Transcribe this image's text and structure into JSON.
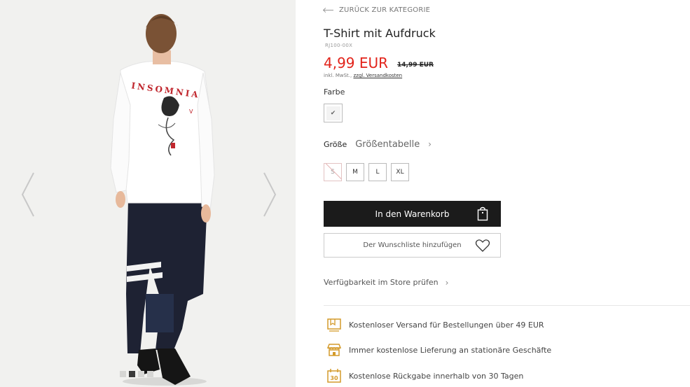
{
  "gallery": {
    "print_text": "INSOMNIA",
    "dots_count": 4,
    "active_dot": 1
  },
  "product": {
    "back_label": "ZURÜCK ZUR KATEGORIE",
    "title": "T-Shirt mit Aufdruck",
    "sku": "RJ100-00X",
    "price": "4,99 EUR",
    "old_price": "14,99 EUR",
    "tax_text": "inkl. MwSt., ",
    "shipping_link": "zzgl. Versandkosten",
    "color_label": "Farbe",
    "size_label": "Größe",
    "size_table_label": "Größentabelle",
    "sizes": [
      {
        "label": "S",
        "available": false
      },
      {
        "label": "M",
        "available": true
      },
      {
        "label": "L",
        "available": true
      },
      {
        "label": "XL",
        "available": true
      }
    ],
    "add_to_cart": "In den Warenkorb",
    "wishlist": "Der Wunschliste hinzufügen",
    "store_availability": "Verfügbarkeit im Store prüfen"
  },
  "benefits": [
    {
      "icon": "truck-icon",
      "text": "Kostenloser Versand für Bestellungen über 49 EUR"
    },
    {
      "icon": "store-icon",
      "text": "Immer kostenlose Lieferung an stationäre Geschäfte"
    },
    {
      "icon": "calendar-30-icon",
      "text": "Kostenlose Rückgabe innerhalb von 30 Tagen"
    }
  ],
  "colors": {
    "price_red": "#e2231a",
    "button_dark": "#1b1b1b",
    "icon_gold": "#d49a2a"
  }
}
